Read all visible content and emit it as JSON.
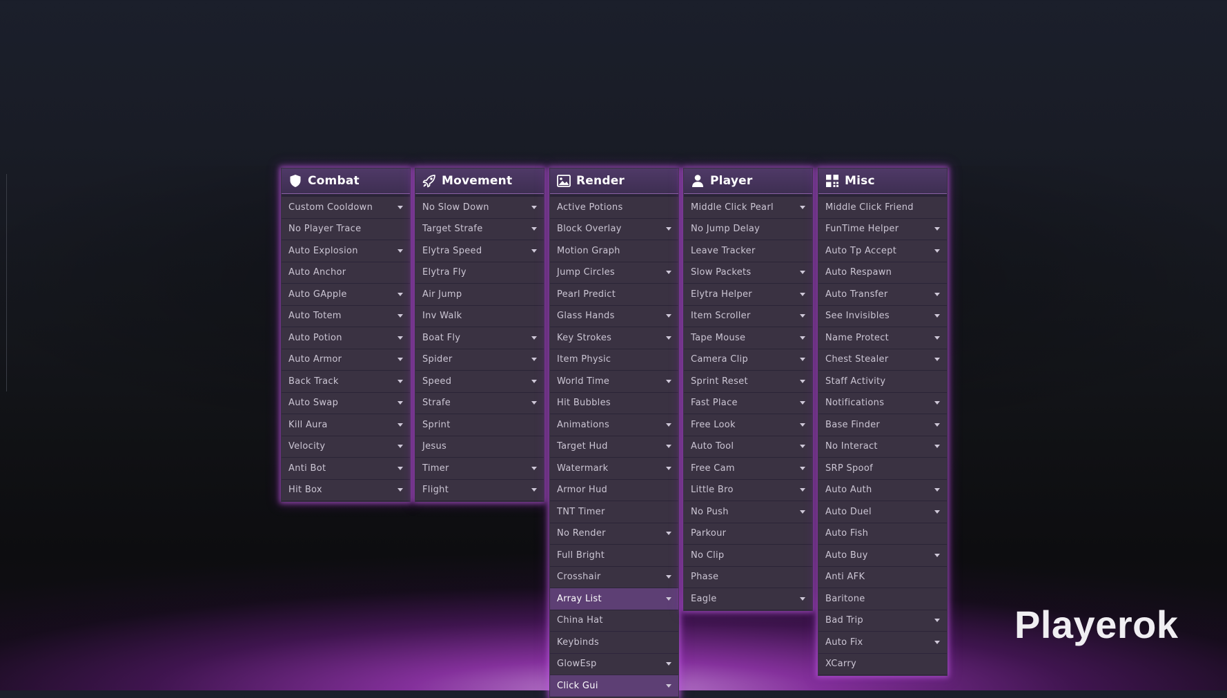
{
  "panels": [
    {
      "title": "Combat",
      "icon": "shield-icon",
      "items": [
        {
          "label": "Custom Cooldown",
          "has_settings": true,
          "active": false
        },
        {
          "label": "No Player Trace",
          "has_settings": false,
          "active": false
        },
        {
          "label": "Auto Explosion",
          "has_settings": true,
          "active": false
        },
        {
          "label": "Auto Anchor",
          "has_settings": false,
          "active": false
        },
        {
          "label": "Auto GApple",
          "has_settings": true,
          "active": false
        },
        {
          "label": "Auto Totem",
          "has_settings": true,
          "active": false
        },
        {
          "label": "Auto Potion",
          "has_settings": true,
          "active": false
        },
        {
          "label": "Auto Armor",
          "has_settings": true,
          "active": false
        },
        {
          "label": "Back Track",
          "has_settings": true,
          "active": false
        },
        {
          "label": "Auto Swap",
          "has_settings": true,
          "active": false
        },
        {
          "label": "Kill Aura",
          "has_settings": true,
          "active": false
        },
        {
          "label": "Velocity",
          "has_settings": true,
          "active": false
        },
        {
          "label": "Anti Bot",
          "has_settings": true,
          "active": false
        },
        {
          "label": "Hit Box",
          "has_settings": true,
          "active": false
        }
      ]
    },
    {
      "title": "Movement",
      "icon": "rocket-icon",
      "items": [
        {
          "label": "No Slow Down",
          "has_settings": true,
          "active": false
        },
        {
          "label": "Target Strafe",
          "has_settings": true,
          "active": false
        },
        {
          "label": "Elytra Speed",
          "has_settings": true,
          "active": false
        },
        {
          "label": "Elytra Fly",
          "has_settings": false,
          "active": false
        },
        {
          "label": "Air Jump",
          "has_settings": false,
          "active": false
        },
        {
          "label": "Inv Walk",
          "has_settings": false,
          "active": false
        },
        {
          "label": "Boat Fly",
          "has_settings": true,
          "active": false
        },
        {
          "label": "Spider",
          "has_settings": true,
          "active": false
        },
        {
          "label": "Speed",
          "has_settings": true,
          "active": false
        },
        {
          "label": "Strafe",
          "has_settings": true,
          "active": false
        },
        {
          "label": "Sprint",
          "has_settings": false,
          "active": false
        },
        {
          "label": "Jesus",
          "has_settings": false,
          "active": false
        },
        {
          "label": "Timer",
          "has_settings": true,
          "active": false
        },
        {
          "label": "Flight",
          "has_settings": true,
          "active": false
        }
      ]
    },
    {
      "title": "Render",
      "icon": "image-icon",
      "items": [
        {
          "label": "Active Potions",
          "has_settings": false,
          "active": false
        },
        {
          "label": "Block Overlay",
          "has_settings": true,
          "active": false
        },
        {
          "label": "Motion Graph",
          "has_settings": false,
          "active": false
        },
        {
          "label": "Jump Circles",
          "has_settings": true,
          "active": false
        },
        {
          "label": "Pearl Predict",
          "has_settings": false,
          "active": false
        },
        {
          "label": "Glass Hands",
          "has_settings": true,
          "active": false
        },
        {
          "label": "Key Strokes",
          "has_settings": true,
          "active": false
        },
        {
          "label": "Item Physic",
          "has_settings": false,
          "active": false
        },
        {
          "label": "World Time",
          "has_settings": true,
          "active": false
        },
        {
          "label": "Hit Bubbles",
          "has_settings": false,
          "active": false
        },
        {
          "label": "Animations",
          "has_settings": true,
          "active": false
        },
        {
          "label": "Target Hud",
          "has_settings": true,
          "active": false
        },
        {
          "label": "Watermark",
          "has_settings": true,
          "active": false
        },
        {
          "label": "Armor Hud",
          "has_settings": false,
          "active": false
        },
        {
          "label": "TNT Timer",
          "has_settings": false,
          "active": false
        },
        {
          "label": "No Render",
          "has_settings": true,
          "active": false
        },
        {
          "label": "Full Bright",
          "has_settings": false,
          "active": false
        },
        {
          "label": "Crosshair",
          "has_settings": true,
          "active": false
        },
        {
          "label": "Array List",
          "has_settings": true,
          "active": true
        },
        {
          "label": "China Hat",
          "has_settings": false,
          "active": false
        },
        {
          "label": "Keybinds",
          "has_settings": false,
          "active": false
        },
        {
          "label": "GlowEsp",
          "has_settings": true,
          "active": false
        },
        {
          "label": "Click Gui",
          "has_settings": true,
          "active": true
        }
      ]
    },
    {
      "title": "Player",
      "icon": "user-icon",
      "items": [
        {
          "label": "Middle Click Pearl",
          "has_settings": true,
          "active": false
        },
        {
          "label": "No Jump Delay",
          "has_settings": false,
          "active": false
        },
        {
          "label": "Leave Tracker",
          "has_settings": false,
          "active": false
        },
        {
          "label": "Slow Packets",
          "has_settings": true,
          "active": false
        },
        {
          "label": "Elytra Helper",
          "has_settings": true,
          "active": false
        },
        {
          "label": "Item Scroller",
          "has_settings": true,
          "active": false
        },
        {
          "label": "Tape Mouse",
          "has_settings": true,
          "active": false
        },
        {
          "label": "Camera Clip",
          "has_settings": true,
          "active": false
        },
        {
          "label": "Sprint Reset",
          "has_settings": true,
          "active": false
        },
        {
          "label": "Fast Place",
          "has_settings": true,
          "active": false
        },
        {
          "label": "Free Look",
          "has_settings": true,
          "active": false
        },
        {
          "label": "Auto Tool",
          "has_settings": true,
          "active": false
        },
        {
          "label": "Free Cam",
          "has_settings": true,
          "active": false
        },
        {
          "label": "Little Bro",
          "has_settings": true,
          "active": false
        },
        {
          "label": "No Push",
          "has_settings": true,
          "active": false
        },
        {
          "label": "Parkour",
          "has_settings": false,
          "active": false
        },
        {
          "label": "No Clip",
          "has_settings": false,
          "active": false
        },
        {
          "label": "Phase",
          "has_settings": false,
          "active": false
        },
        {
          "label": "Eagle",
          "has_settings": true,
          "active": false
        }
      ]
    },
    {
      "title": "Misc",
      "icon": "grid-icon",
      "items": [
        {
          "label": "Middle Click Friend",
          "has_settings": false,
          "active": false
        },
        {
          "label": "FunTime Helper",
          "has_settings": true,
          "active": false
        },
        {
          "label": "Auto Tp Accept",
          "has_settings": true,
          "active": false
        },
        {
          "label": "Auto Respawn",
          "has_settings": false,
          "active": false
        },
        {
          "label": "Auto Transfer",
          "has_settings": true,
          "active": false
        },
        {
          "label": "See Invisibles",
          "has_settings": true,
          "active": false
        },
        {
          "label": "Name Protect",
          "has_settings": true,
          "active": false
        },
        {
          "label": "Chest Stealer",
          "has_settings": true,
          "active": false
        },
        {
          "label": "Staff Activity",
          "has_settings": false,
          "active": false
        },
        {
          "label": "Notifications",
          "has_settings": true,
          "active": false
        },
        {
          "label": "Base Finder",
          "has_settings": true,
          "active": false
        },
        {
          "label": "No Interact",
          "has_settings": true,
          "active": false
        },
        {
          "label": "SRP Spoof",
          "has_settings": false,
          "active": false
        },
        {
          "label": "Auto Auth",
          "has_settings": true,
          "active": false
        },
        {
          "label": "Auto Duel",
          "has_settings": true,
          "active": false
        },
        {
          "label": "Auto Fish",
          "has_settings": false,
          "active": false
        },
        {
          "label": "Auto Buy",
          "has_settings": true,
          "active": false
        },
        {
          "label": "Anti AFK",
          "has_settings": false,
          "active": false
        },
        {
          "label": "Baritone",
          "has_settings": false,
          "active": false
        },
        {
          "label": "Bad Trip",
          "has_settings": true,
          "active": false
        },
        {
          "label": "Auto Fix",
          "has_settings": true,
          "active": false
        },
        {
          "label": "XCarry",
          "has_settings": false,
          "active": false
        }
      ]
    }
  ],
  "branding": {
    "text": "Playerok"
  },
  "colors": {
    "accent": "#c060e8",
    "panel_bg": "#2c2538",
    "item_bg": "#3a3242",
    "item_active": "#5d3f74"
  }
}
